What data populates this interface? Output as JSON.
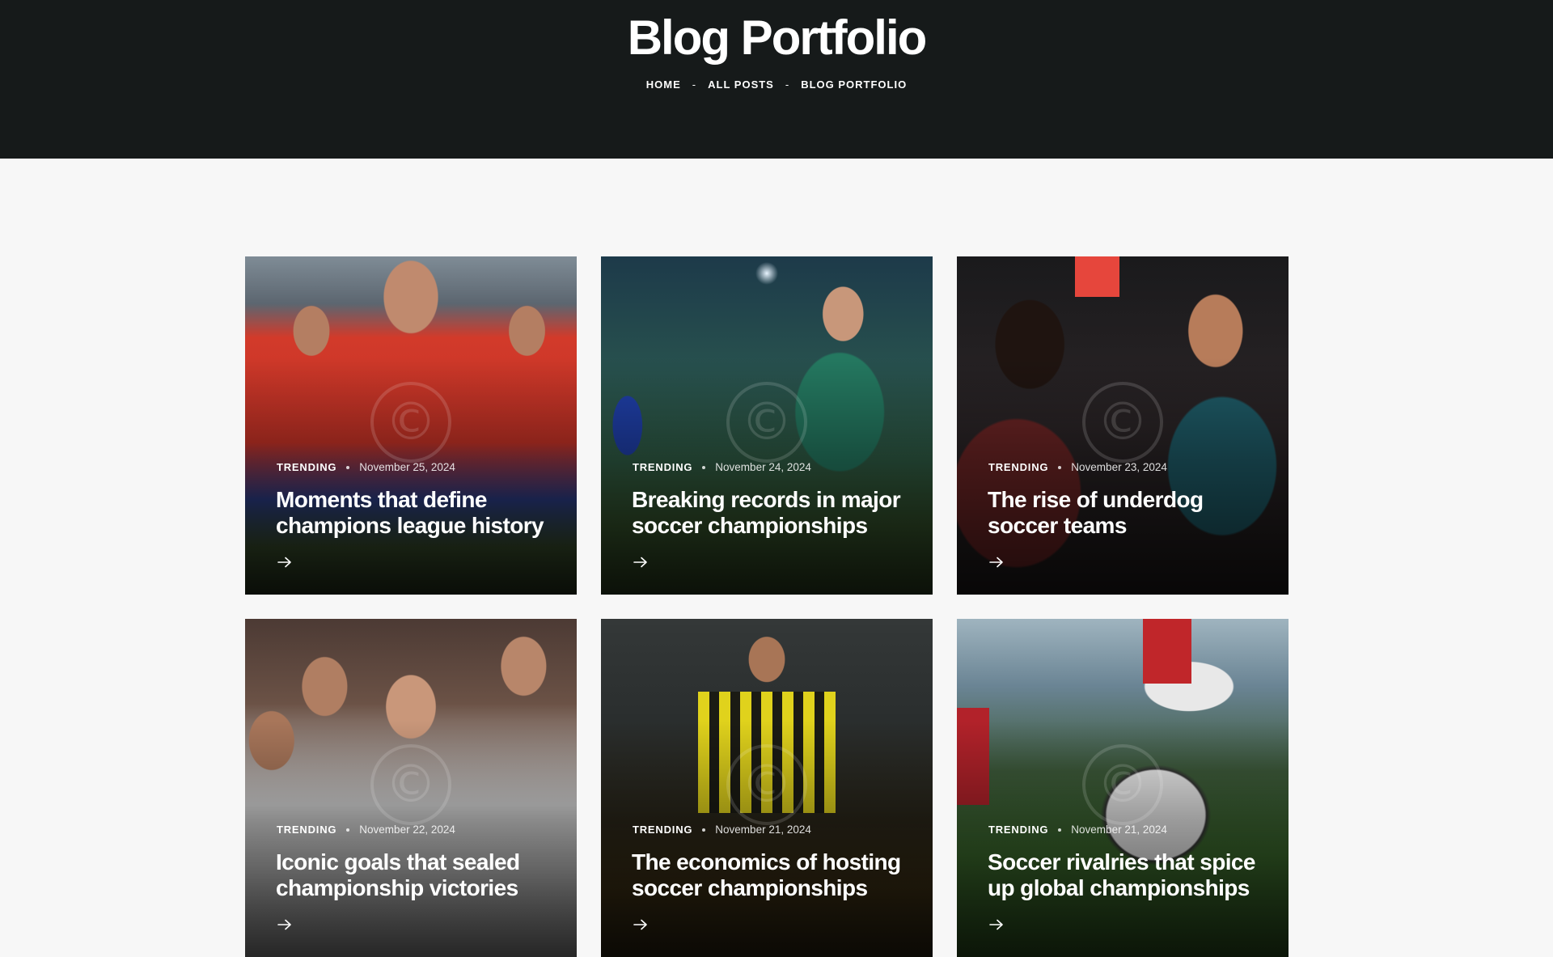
{
  "hero": {
    "title": "Blog Portfolio",
    "breadcrumb": [
      {
        "label": "HOME"
      },
      {
        "label": "ALL POSTS"
      },
      {
        "label": "BLOG PORTFOLIO"
      }
    ],
    "separator": "-"
  },
  "posts": [
    {
      "category": "TRENDING",
      "date": "November 25, 2024",
      "title": "Moments that define champions league history"
    },
    {
      "category": "TRENDING",
      "date": "November 24, 2024",
      "title": "Breaking records in major soccer championships"
    },
    {
      "category": "TRENDING",
      "date": "November 23, 2024",
      "title": "The rise of underdog soccer teams"
    },
    {
      "category": "TRENDING",
      "date": "November 22, 2024",
      "title": "Iconic goals that sealed championship victories"
    },
    {
      "category": "TRENDING",
      "date": "November 21, 2024",
      "title": "The economics of hosting soccer championships"
    },
    {
      "category": "TRENDING",
      "date": "November 21, 2024",
      "title": "Soccer rivalries that spice up global championships"
    }
  ],
  "icons": {
    "arrow": "arrow-right-icon",
    "watermark": "copyright-watermark"
  },
  "colors": {
    "header_bg": "#161a1a",
    "page_bg": "#f7f7f7",
    "text_light": "#ffffff"
  }
}
